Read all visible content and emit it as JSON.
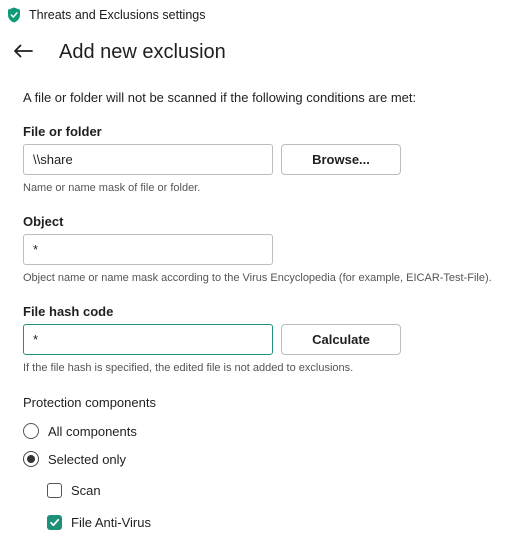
{
  "window": {
    "title": "Threats and Exclusions settings",
    "app_icon": "kaspersky-shield-icon"
  },
  "header": {
    "back_icon": "arrow-left-icon",
    "title": "Add new exclusion"
  },
  "intro": "A file or folder will not be scanned if the following conditions are met:",
  "file_or_folder": {
    "label": "File or folder",
    "value": "\\\\share",
    "button": "Browse...",
    "hint": "Name or name mask of file or folder."
  },
  "object": {
    "label": "Object",
    "value": "*",
    "hint": "Object name or name mask according to the Virus Encyclopedia (for example, EICAR-Test-File)."
  },
  "file_hash": {
    "label": "File hash code",
    "value": "*",
    "button": "Calculate",
    "hint": "If the file hash is specified, the edited file is not added to exclusions."
  },
  "protection": {
    "label": "Protection components",
    "options": [
      {
        "label": "All components",
        "selected": false
      },
      {
        "label": "Selected only",
        "selected": true
      }
    ],
    "components": [
      {
        "label": "Scan",
        "checked": false
      },
      {
        "label": "File Anti-Virus",
        "checked": true
      }
    ]
  },
  "colors": {
    "accent": "#1e8f78"
  }
}
